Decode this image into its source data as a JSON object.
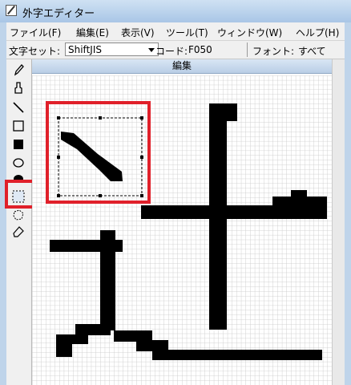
{
  "window": {
    "title": "外字エディター"
  },
  "menu": {
    "items": [
      {
        "label": "ファイル(F)"
      },
      {
        "label": "編集(E)"
      },
      {
        "label": "表示(V)"
      },
      {
        "label": "ツール(T)"
      },
      {
        "label": "ウィンドウ(W)"
      },
      {
        "label": "ヘルプ(H)"
      }
    ]
  },
  "toolbar": {
    "charset_label": "文字セット:",
    "charset_value": "ShiftJIS",
    "code_label": "コード:",
    "code_value": "F050",
    "font_label": "フォント:",
    "font_value": "すべて"
  },
  "editor": {
    "header": "編集"
  },
  "tools": [
    {
      "name": "pencil-tool",
      "icon": "pencil-icon"
    },
    {
      "name": "brush-tool",
      "icon": "brush-icon"
    },
    {
      "name": "line-tool",
      "icon": "line-icon"
    },
    {
      "name": "hollow-rectangle-tool",
      "icon": "hollow-rectangle-icon"
    },
    {
      "name": "filled-rectangle-tool",
      "icon": "filled-rectangle-icon"
    },
    {
      "name": "hollow-ellipse-tool",
      "icon": "hollow-ellipse-icon"
    },
    {
      "name": "filled-ellipse-tool",
      "icon": "filled-ellipse-icon"
    },
    {
      "name": "rectangle-select-tool",
      "icon": "rectangle-select-icon",
      "selected": true
    },
    {
      "name": "freeform-select-tool",
      "icon": "freeform-select-icon"
    },
    {
      "name": "eraser-tool",
      "icon": "eraser-icon"
    }
  ],
  "colors": {
    "highlight": "#e0202a",
    "pixel_on": "#000000",
    "grid_line": "#c8c8c8"
  }
}
